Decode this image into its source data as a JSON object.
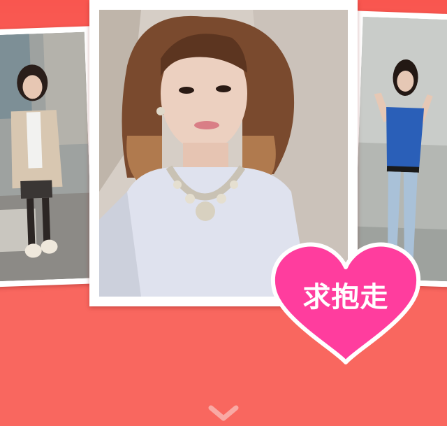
{
  "photos": {
    "left": {
      "icon": "photo-woman-blazer"
    },
    "center": {
      "icon": "photo-woman-necklace"
    },
    "right": {
      "icon": "photo-woman-blue-tshirt"
    }
  },
  "badge": {
    "label": "求抱走",
    "icon": "heart-icon",
    "fill_color": "#ff3d9e",
    "stroke_color": "#ffffff"
  },
  "navigation": {
    "next_icon": "chevron-down-icon"
  },
  "colors": {
    "background": "#f9675f",
    "card": "#ffffff"
  }
}
